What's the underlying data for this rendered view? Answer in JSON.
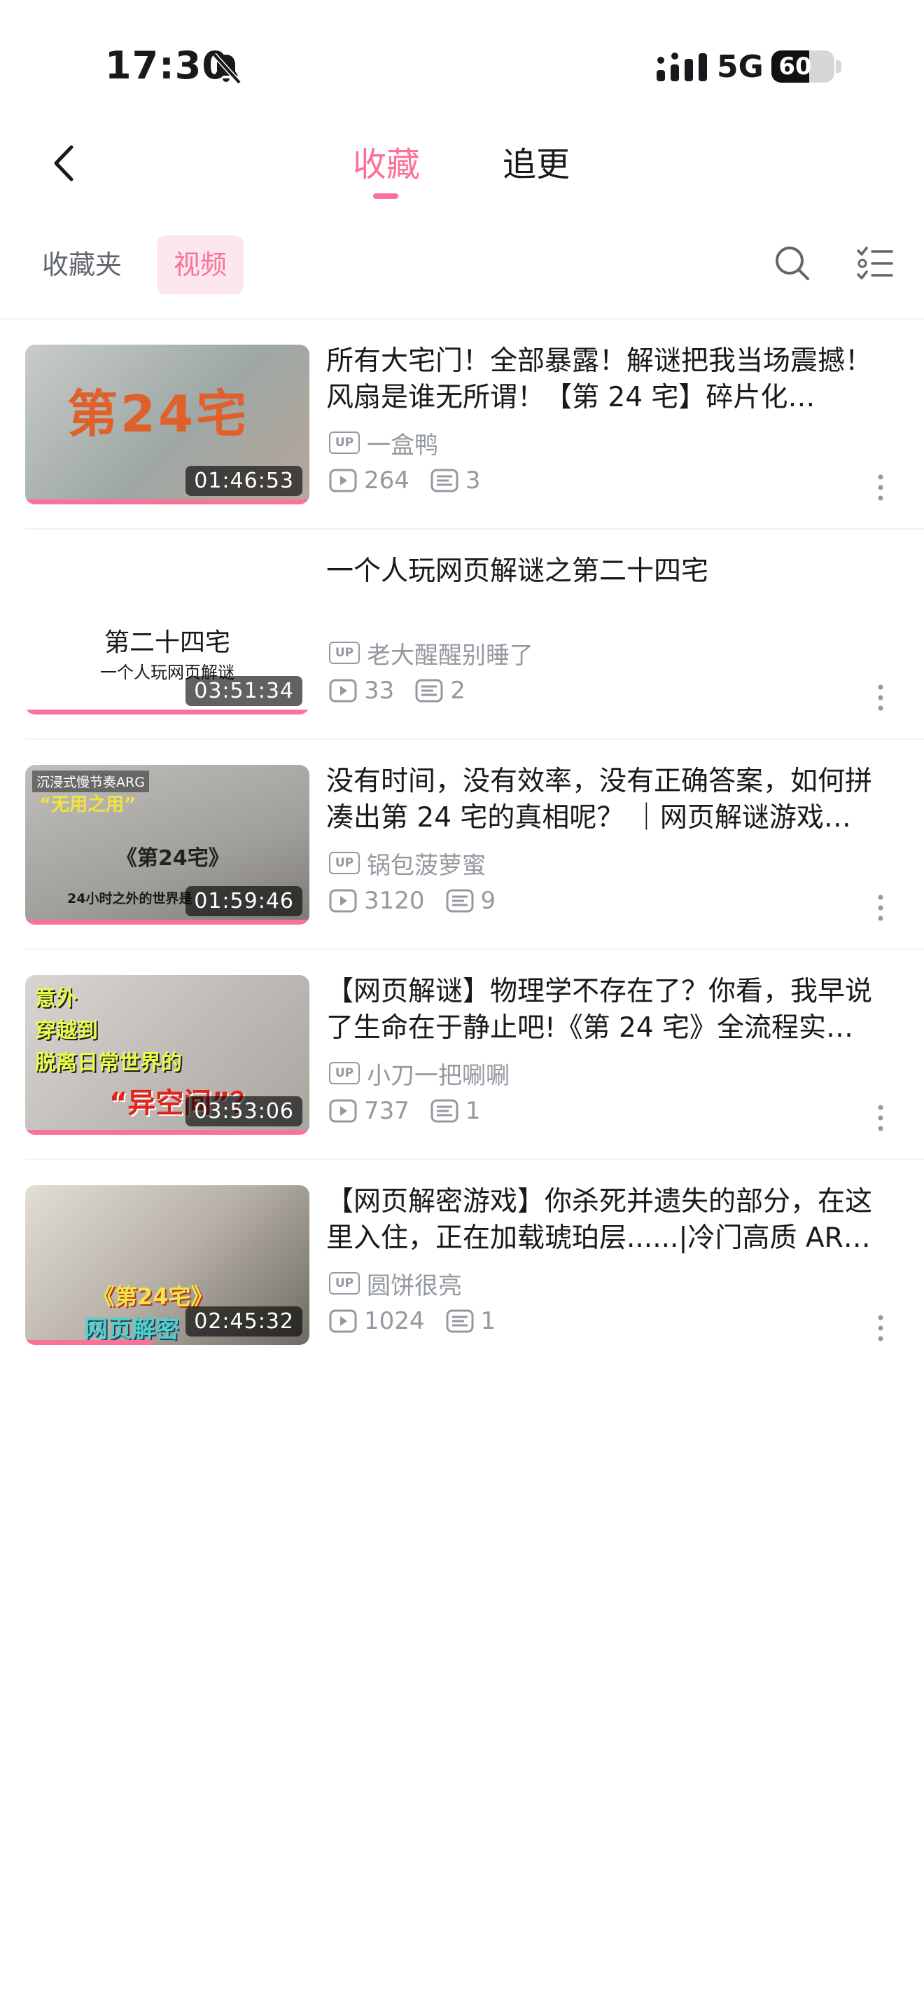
{
  "status_bar": {
    "time": "17:30",
    "network": "5G",
    "battery": 60
  },
  "nav": {
    "tab_favorites": "收藏",
    "tab_following": "追更"
  },
  "subnav": {
    "folders": "收藏夹",
    "videos": "视频"
  },
  "colors": {
    "accent": "#fb7299",
    "accent_light": "#fde7ee",
    "text_primary": "#18191c",
    "text_secondary": "#9499a0"
  },
  "icons": [
    "back-icon",
    "bell-muted-icon",
    "signal-icon",
    "search-icon",
    "list-manage-icon",
    "play-count-icon",
    "danmaku-icon",
    "more-icon"
  ],
  "videos": [
    {
      "title": "所有大宅门！全部暴露！解谜把我当场震撼！风扇是谁无所谓！【第 24 宅】碎片化…",
      "uploader": "一盒鸭",
      "plays": "264",
      "comments": "3",
      "duration": "01:46:53",
      "progress": 1.0,
      "thumb_text": "第24宅"
    },
    {
      "title": "一个人玩网页解谜之第二十四宅",
      "uploader": "老大醒醒别睡了",
      "plays": "33",
      "comments": "2",
      "duration": "03:51:34",
      "progress": 1.0,
      "thumb_title": "第二十四宅",
      "thumb_sub": "一个人玩网页解谜"
    },
    {
      "title": "没有时间，没有效率，没有正确答案，如何拼凑出第 24 宅的真相呢？ ｜网页解谜游戏…",
      "uploader": "锅包菠萝蜜",
      "plays": "3120",
      "comments": "9",
      "duration": "01:59:46",
      "progress": 1.0,
      "thumb_tag": "沉浸式慢节奏ARG",
      "thumb_quote": "“无用之用”",
      "thumb_name": "《第24宅》",
      "thumb_caption": "24小时之外的世界是"
    },
    {
      "title": "【网页解谜】物理学不存在了？你看，我早说了生命在于静止吧!《第 24 宅》全流程实…",
      "uploader": "小刀一把唰唰",
      "plays": "737",
      "comments": "1",
      "duration": "03:53:06",
      "progress": 1.0,
      "thumb_line1": "意外",
      "thumb_line2": "穿越到",
      "thumb_line3": "脱离日常世界的",
      "thumb_line4": "“异空间”？"
    },
    {
      "title": "【网页解密游戏】你杀死并遗失的部分，在这里入住，正在加载琥珀层......|冷门高质 AR…",
      "uploader": "圆饼很亮",
      "plays": "1024",
      "comments": "1",
      "duration": "02:45:32",
      "progress": 0.45,
      "thumb_name": "《第24宅》",
      "thumb_genre": "网页解密"
    }
  ]
}
